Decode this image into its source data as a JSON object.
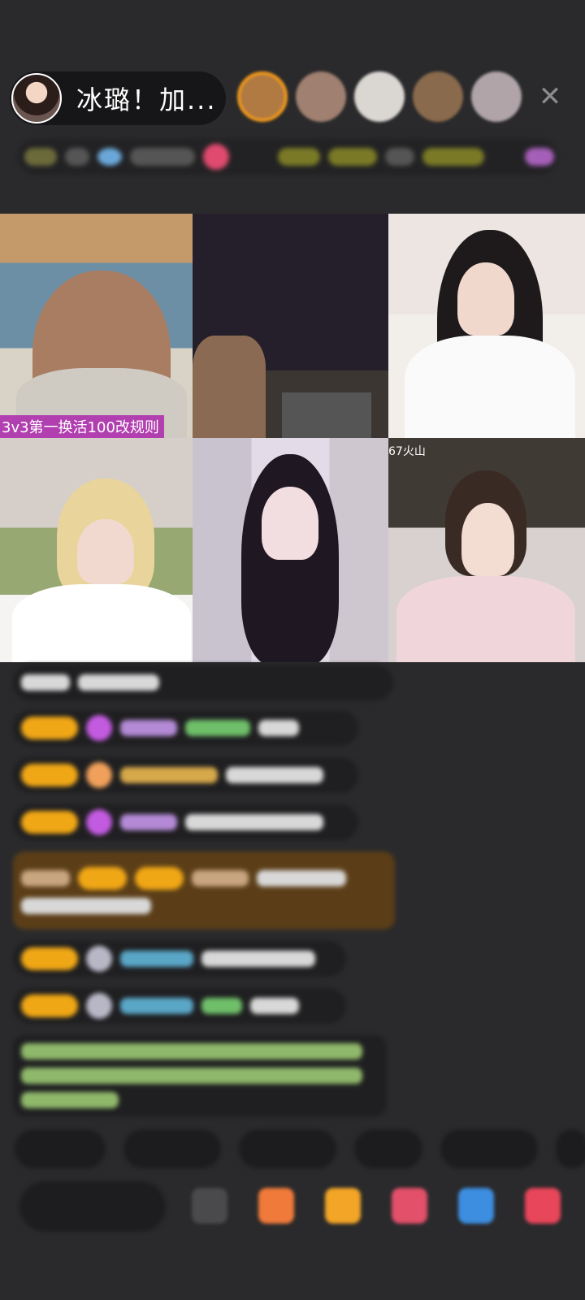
{
  "header": {
    "host_name": "冰璐！加...",
    "close_icon": "close-icon",
    "viewer_colors": [
      "#b07a42",
      "#a08070",
      "#dad6d2",
      "#8a6a4c",
      "#b0a4a8"
    ]
  },
  "grid": {
    "tile1_caption": "3v3第一换活100改规则",
    "tile6_tag": "67火山"
  },
  "colors": {
    "background": "#2a2a2c",
    "level_badge": "#f0a715",
    "caption_bg": "#b13fb0",
    "highlight_msg": "#5b3e18"
  }
}
